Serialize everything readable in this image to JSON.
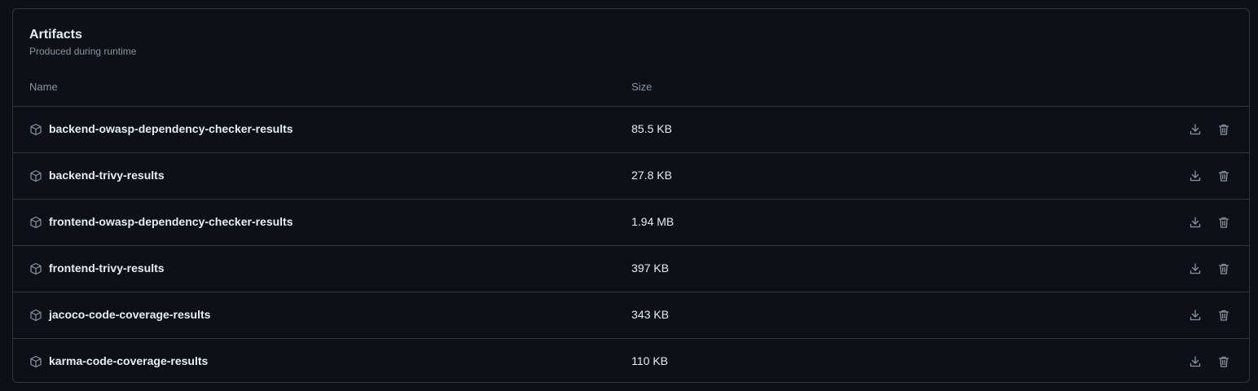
{
  "artifacts": {
    "title": "Artifacts",
    "subtitle": "Produced during runtime",
    "columns": {
      "name": "Name",
      "size": "Size"
    },
    "items": [
      {
        "name": "backend-owasp-dependency-checker-results",
        "size": "85.5 KB"
      },
      {
        "name": "backend-trivy-results",
        "size": "27.8 KB"
      },
      {
        "name": "frontend-owasp-dependency-checker-results",
        "size": "1.94 MB"
      },
      {
        "name": "frontend-trivy-results",
        "size": "397 KB"
      },
      {
        "name": "jacoco-code-coverage-results",
        "size": "343 KB"
      },
      {
        "name": "karma-code-coverage-results",
        "size": "110 KB"
      }
    ],
    "icons": {
      "item": "package-icon",
      "download": "download-icon",
      "delete": "trash-icon"
    },
    "colors": {
      "background": "#0d1117",
      "border": "#30363d",
      "text": "#e6edf3",
      "muted": "#8b949e"
    }
  }
}
